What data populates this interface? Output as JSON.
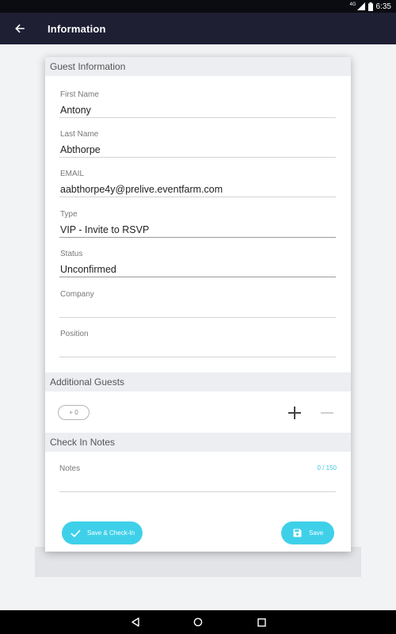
{
  "status_bar": {
    "network": "4G",
    "time": "6:35",
    "icons": [
      "signal-icon",
      "battery-icon"
    ]
  },
  "app_bar": {
    "title": "Information",
    "back_icon": "arrow-left-icon"
  },
  "guest_information": {
    "header": "Guest Information",
    "fields": [
      {
        "label": "First Name",
        "value": "Antony"
      },
      {
        "label": "Last Name",
        "value": "Abthorpe"
      },
      {
        "label": "EMAIL",
        "value": "aabthorpe4y@prelive.eventfarm.com"
      },
      {
        "label": "Type",
        "value": "VIP - Invite to RSVP"
      },
      {
        "label": "Status",
        "value": "Unconfirmed"
      },
      {
        "label": "Company",
        "value": ""
      },
      {
        "label": "Position",
        "value": ""
      }
    ]
  },
  "additional_guests": {
    "header": "Additional Guests",
    "counter": "+ 0",
    "plus_icon": "plus-icon",
    "minus_icon": "minus-icon"
  },
  "check_in_notes": {
    "header": "Check In Notes",
    "label": "Notes",
    "count": "0 / 150"
  },
  "actions": {
    "save_checkin_label": "Save & Check-In",
    "save_label": "Save"
  },
  "colors": {
    "app_bar": "#1e1f33",
    "accent": "#3fd0e9",
    "section_header": "#eceef1"
  },
  "nav_bar": {
    "icons": [
      "back-triangle-icon",
      "home-circle-icon",
      "recents-square-icon"
    ]
  }
}
